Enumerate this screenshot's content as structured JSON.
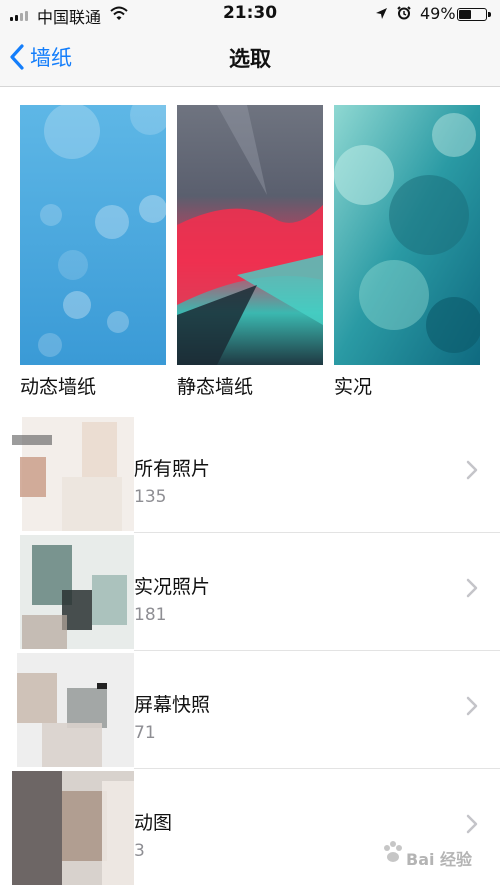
{
  "status_bar": {
    "carrier": "中国联通",
    "time": "21:30",
    "battery_percent": "49%",
    "battery_level": 0.49,
    "icons": [
      "signal-icon",
      "wifi-icon",
      "location-icon",
      "alarm-icon",
      "battery-icon"
    ]
  },
  "nav": {
    "back_label": "墙纸",
    "title": "选取"
  },
  "wallpapers": [
    {
      "label": "动态墙纸"
    },
    {
      "label": "静态墙纸"
    },
    {
      "label": "实况"
    }
  ],
  "albums": [
    {
      "name": "所有照片",
      "count": "135"
    },
    {
      "name": "实况照片",
      "count": "181"
    },
    {
      "name": "屏幕快照",
      "count": "71"
    },
    {
      "name": "动图",
      "count": "3"
    }
  ],
  "watermark": {
    "text": "Bai 经验"
  },
  "colors": {
    "accent": "#147efb",
    "nav_bg": "#f7f7f7",
    "secondary_text": "#8e8e93"
  }
}
